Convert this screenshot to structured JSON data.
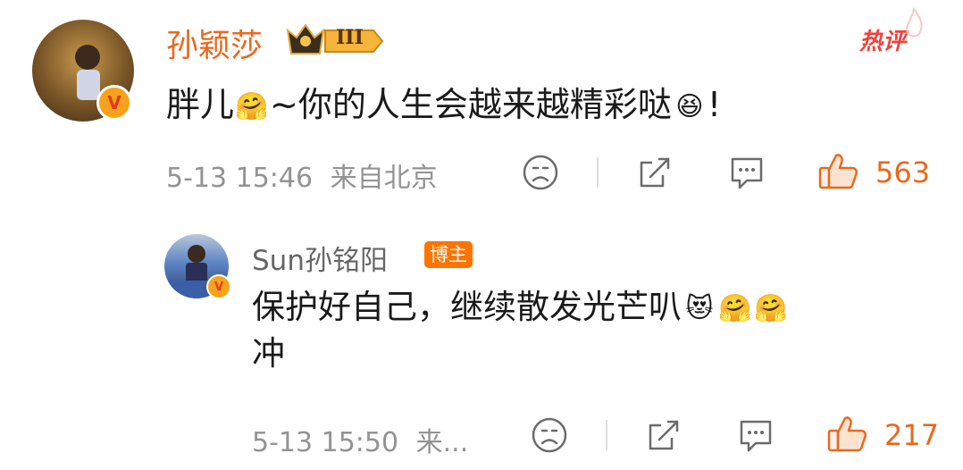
{
  "comment": {
    "username": "孙颖莎",
    "level_badge": "III",
    "hot_tag": "热评",
    "text_part1": "胖儿",
    "text_part2": "~你的人生会越来越精彩哒",
    "text_part3": "!",
    "timestamp": "5-13 15:46",
    "location": "来自北京",
    "like_count": "563",
    "icons": [
      "crown-icon",
      "vip-badge-icon",
      "hug-emoji",
      "excited-emoji",
      "dislike-icon",
      "share-icon",
      "comment-icon",
      "like-icon"
    ]
  },
  "reply": {
    "username": "Sun孙铭阳",
    "role_tag": "博主",
    "text_line1": "保护好自己，继续散发光芒叭",
    "text_line2": "冲",
    "timestamp": "5-13 15:50",
    "location_truncated": "来...",
    "like_count": "217",
    "icons": [
      "love-cat-emoji",
      "hug-emoji",
      "hug-emoji",
      "dislike-icon",
      "share-icon",
      "comment-icon",
      "like-icon"
    ]
  },
  "colors": {
    "accent_orange": "#e9691d",
    "hot_red": "#f0413b",
    "meta_gray": "#939393",
    "tag_orange": "#ff7300"
  }
}
